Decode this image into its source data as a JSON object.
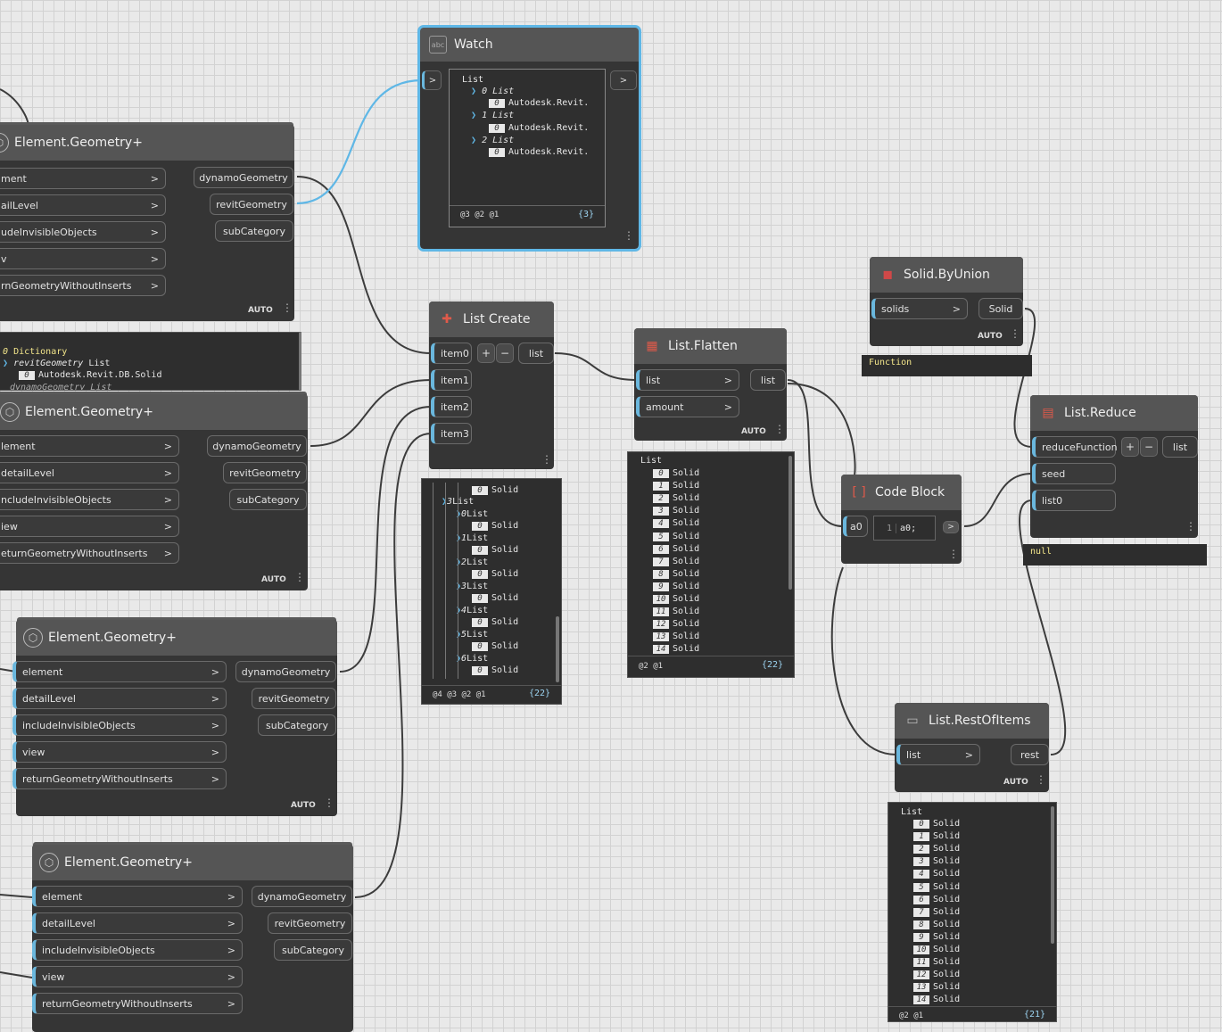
{
  "ports": {
    "eg_inputs": [
      "element",
      "detailLevel",
      "includeInvisibleObjects",
      "view",
      "returnGeometryWithoutInserts"
    ],
    "eg_inputs_clipped1": [
      "ment",
      "ailLevel",
      "udeInvisibleObjects",
      "v",
      "rnGeometryWithoutInserts"
    ],
    "eg_inputs_clipped2": [
      "lement",
      "detailLevel",
      "ncludeInvisibleObjects",
      "iew",
      "eturnGeometryWithoutInserts"
    ],
    "eg_outputs": [
      "dynamoGeometry",
      "revitGeometry",
      "subCategory"
    ],
    "auto": "AUTO",
    "chevron": ">"
  },
  "nodes": {
    "element_geometry_title": "Element.Geometry+",
    "watch": {
      "title": "Watch",
      "icon": "abc"
    },
    "list_create": {
      "title": "List Create",
      "inputs": [
        "item0",
        "item1",
        "item2",
        "item3"
      ],
      "output": "list",
      "plus": "+",
      "minus": "−"
    },
    "list_flatten": {
      "title": "List.Flatten",
      "inputs": [
        "list",
        "amount"
      ],
      "output": "list"
    },
    "solid_byunion": {
      "title": "Solid.ByUnion",
      "input": "solids",
      "output": "Solid",
      "result": "Function"
    },
    "list_reduce": {
      "title": "List.Reduce",
      "inputs": [
        "reduceFunction",
        "seed",
        "list0"
      ],
      "output": "list",
      "result": "null"
    },
    "code_block": {
      "title": "Code Block",
      "input": "a0",
      "line_number": "1",
      "code": "a0;",
      "out": ">"
    },
    "list_restofitems": {
      "title": "List.RestOfItems",
      "input": "list",
      "output": "rest"
    }
  },
  "watch_preview": {
    "lines": [
      "List",
      "0 List",
      "0",
      "Autodesk.Revit.",
      "1 List",
      "0",
      "Autodesk.Revit.",
      "2 List",
      "0",
      "Autodesk.Revit."
    ],
    "footer": "@3 @2 @1",
    "count": "{3}"
  },
  "dict_preview": {
    "line1_idx": "0",
    "line1": "Dictionary",
    "line2": "revitGeometry",
    "line2b": "List",
    "line3_idx": "0",
    "line3": "Autodesk.Revit.DB.Solid",
    "line4": "dynamoGeometry List"
  },
  "listcreate_preview": {
    "rows": [
      {
        "idx": "0",
        "text": "Solid"
      },
      {
        "list": "3",
        "text": "List"
      },
      {
        "list": "0",
        "text": "List"
      },
      {
        "idx": "0",
        "text": "Solid"
      },
      {
        "list": "1",
        "text": "List"
      },
      {
        "idx": "0",
        "text": "Solid"
      },
      {
        "list": "2",
        "text": "List"
      },
      {
        "idx": "0",
        "text": "Solid"
      },
      {
        "list": "3",
        "text": "List"
      },
      {
        "idx": "0",
        "text": "Solid"
      },
      {
        "list": "4",
        "text": "List"
      },
      {
        "idx": "0",
        "text": "Solid"
      },
      {
        "list": "5",
        "text": "List"
      },
      {
        "idx": "0",
        "text": "Solid"
      },
      {
        "list": "6",
        "text": "List"
      },
      {
        "idx": "0",
        "text": "Solid"
      }
    ],
    "footer": "@4 @3 @2 @1",
    "count": "{22}"
  },
  "flatten_preview": {
    "header": "List",
    "item_text": "Solid",
    "indices": [
      "0",
      "1",
      "2",
      "3",
      "4",
      "5",
      "6",
      "7",
      "8",
      "9",
      "10",
      "11",
      "12",
      "13",
      "14"
    ],
    "footer": "@2 @1",
    "count": "{22}"
  },
  "rest_preview": {
    "header": "List",
    "item_text": "Solid",
    "indices": [
      "0",
      "1",
      "2",
      "3",
      "4",
      "5",
      "6",
      "7",
      "8",
      "9",
      "10",
      "11",
      "12",
      "13",
      "14"
    ],
    "footer": "@2 @1",
    "count": "{21}"
  },
  "colors": {
    "wire": "#3a3a3a",
    "wire_selected": "#5fb7e6",
    "node": "#353535",
    "header": "#555555",
    "port_accent": "#6ab7dd"
  }
}
